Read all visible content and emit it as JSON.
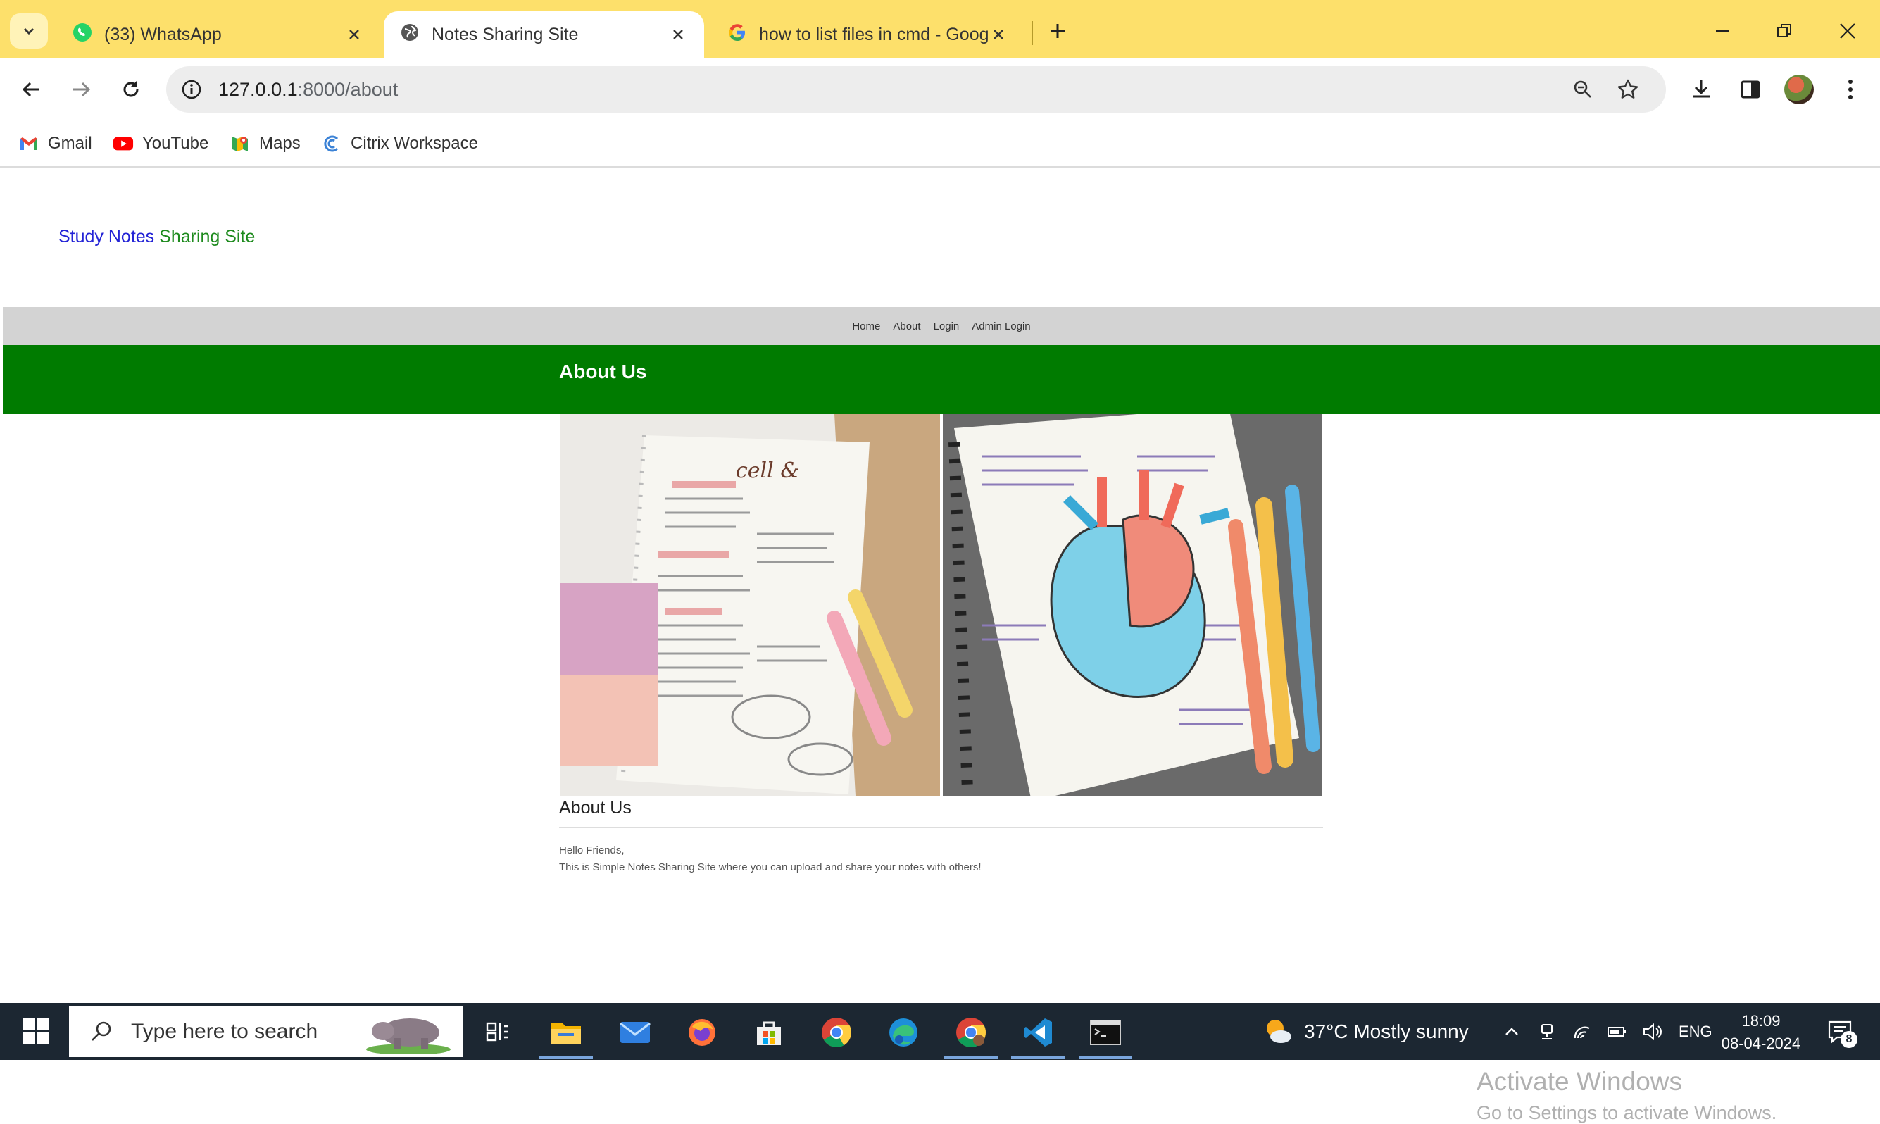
{
  "browser": {
    "tabs": [
      {
        "title": "(33) WhatsApp",
        "icon": "whatsapp-icon",
        "active": false
      },
      {
        "title": "Notes Sharing Site",
        "icon": "globe-icon",
        "active": true
      },
      {
        "title": "how to list files in cmd - Google",
        "icon": "google-icon",
        "active": false
      }
    ],
    "address": {
      "host": "127.0.0.1",
      "rest": ":8000/about"
    },
    "bookmarks": [
      "Gmail",
      "YouTube",
      "Maps",
      "Citrix Workspace"
    ],
    "colors": {
      "tabbar": "#fde06b",
      "omnibox": "#ededed"
    }
  },
  "site": {
    "brand_part1": "Study Notes",
    "brand_part2": "Sharing Site",
    "nav": [
      "Home",
      "About",
      "Login",
      "Admin Login"
    ],
    "banner_title": "About Us",
    "about_heading": "About Us",
    "about_line1": "Hello Friends,",
    "about_line2": "This is Simple Notes Sharing Site where you can upload and share your notes with others!",
    "colors": {
      "brand_blue": "#2323d6",
      "brand_green": "#1d8a1d",
      "banner": "#007b00",
      "nav_strip": "#d3d3d3"
    }
  },
  "watermark": {
    "line1": "Activate Windows",
    "line2": "Go to Settings to activate Windows."
  },
  "taskbar": {
    "search_placeholder": "Type here to search",
    "weather": "37°C  Mostly sunny",
    "lang": "ENG",
    "time": "18:09",
    "date": "08-04-2024",
    "notifications": "8",
    "apps": [
      "task-view-icon",
      "file-explorer-icon",
      "mail-icon",
      "firefox-icon",
      "store-icon",
      "chrome-icon",
      "edge-icon",
      "chrome-active-icon",
      "vscode-icon",
      "terminal-icon"
    ]
  }
}
